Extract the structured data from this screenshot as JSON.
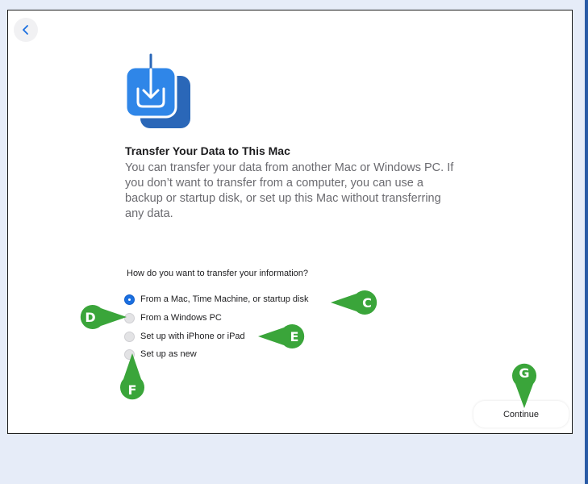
{
  "window": {
    "title": "Transfer Your Data to This Mac",
    "description": "You can transfer your data from another Mac or Windows PC. If you don’t want to transfer from a computer, you can use a backup or startup disk, or set up this Mac without transferring any data.",
    "question": "How do you want to transfer your information?",
    "options": [
      {
        "label": "From a Mac, Time Machine, or startup disk",
        "selected": true
      },
      {
        "label": "From a Windows PC",
        "selected": false
      },
      {
        "label": "Set up with iPhone or iPad",
        "selected": false
      },
      {
        "label": "Set up as new",
        "selected": false
      }
    ],
    "continue_label": "Continue",
    "back_icon": "chevron-left-icon",
    "app_icon": "transfer-download-icon"
  },
  "callouts": {
    "c": "C",
    "d": "D",
    "e": "E",
    "f": "F",
    "g": "G"
  },
  "colors": {
    "accent": "#1a6fe0",
    "callout_green": "#3aa53a",
    "page_bg": "#e6ecf8",
    "page_border": "#2a5ba6"
  }
}
